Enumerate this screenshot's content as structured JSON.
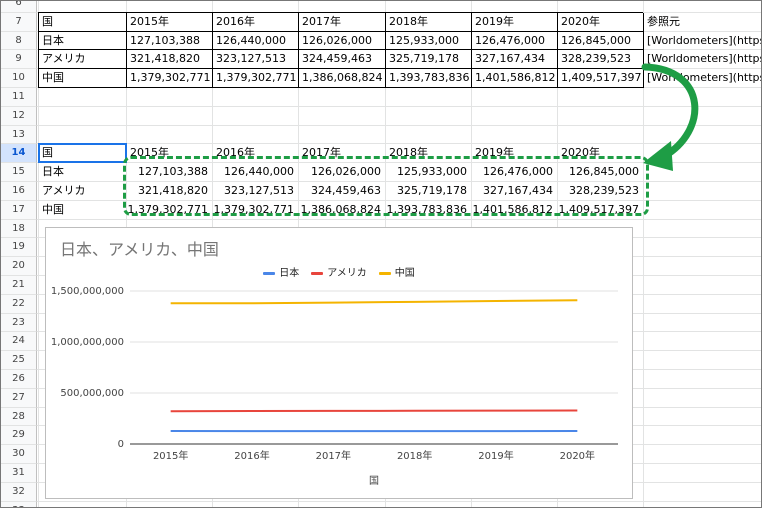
{
  "sheet": {
    "row_numbers": [
      "6",
      "7",
      "8",
      "9",
      "10",
      "11",
      "12",
      "13",
      "14",
      "15",
      "16",
      "17",
      "18",
      "19",
      "20",
      "21",
      "22",
      "23",
      "24",
      "25",
      "26",
      "27",
      "28",
      "29",
      "30",
      "31",
      "32",
      "33"
    ],
    "active_row": "14",
    "top_table": {
      "headers": [
        "国",
        "2015年",
        "2016年",
        "2017年",
        "2018年",
        "2019年",
        "2020年",
        "参照元"
      ],
      "rows": [
        {
          "label": "日本",
          "values": [
            "127,103,388",
            "126,440,000",
            "126,026,000",
            "125,933,000",
            "126,476,000",
            "126,845,000"
          ],
          "source": "[Worldometers](https://"
        },
        {
          "label": "アメリカ",
          "values": [
            "321,418,820",
            "323,127,513",
            "324,459,463",
            "325,719,178",
            "327,167,434",
            "328,239,523"
          ],
          "source": "[Worldometers](https://"
        },
        {
          "label": "中国",
          "values": [
            "1,379,302,771",
            "1,379,302,771",
            "1,386,068,824",
            "1,393,783,836",
            "1,401,586,812",
            "1,409,517,397"
          ],
          "source": "[Worldometers](https://"
        }
      ]
    },
    "lower_table": {
      "headers": [
        "国",
        "2015年",
        "2016年",
        "2017年",
        "2018年",
        "2019年",
        "2020年"
      ],
      "rows": [
        {
          "label": "日本",
          "values": [
            "127,103,388",
            "126,440,000",
            "126,026,000",
            "125,933,000",
            "126,476,000",
            "126,845,000"
          ]
        },
        {
          "label": "アメリカ",
          "values": [
            "321,418,820",
            "323,127,513",
            "324,459,463",
            "325,719,178",
            "327,167,434",
            "328,239,523"
          ]
        },
        {
          "label": "中国",
          "values": [
            "1,379,302,771",
            "1,379,302,771",
            "1,386,068,824",
            "1,393,783,836",
            "1,401,586,812",
            "1,409,517,397"
          ]
        }
      ]
    }
  },
  "colors": {
    "highlight": "#1e9d45",
    "selection": "#1a73e8",
    "japan": "#4a86e8",
    "usa": "#e8453c",
    "china": "#f4b400"
  },
  "chart_data": {
    "type": "line",
    "title": "日本、アメリカ、中国",
    "xlabel": "国",
    "ylabel": "",
    "categories": [
      "2015年",
      "2016年",
      "2017年",
      "2018年",
      "2019年",
      "2020年"
    ],
    "series": [
      {
        "name": "日本",
        "color": "#4a86e8",
        "values": [
          127103388,
          126440000,
          126026000,
          125933000,
          126476000,
          126845000
        ]
      },
      {
        "name": "アメリカ",
        "color": "#e8453c",
        "values": [
          321418820,
          323127513,
          324459463,
          325719178,
          327167434,
          328239523
        ]
      },
      {
        "name": "中国",
        "color": "#f4b400",
        "values": [
          1379302771,
          1379302771,
          1386068824,
          1393783836,
          1401586812,
          1409517397
        ]
      }
    ],
    "yticks": [
      "0",
      "500,000,000",
      "1,000,000,000",
      "1,500,000,000"
    ],
    "ylim": [
      0,
      1500000000
    ],
    "grid": true,
    "legend": "top"
  }
}
